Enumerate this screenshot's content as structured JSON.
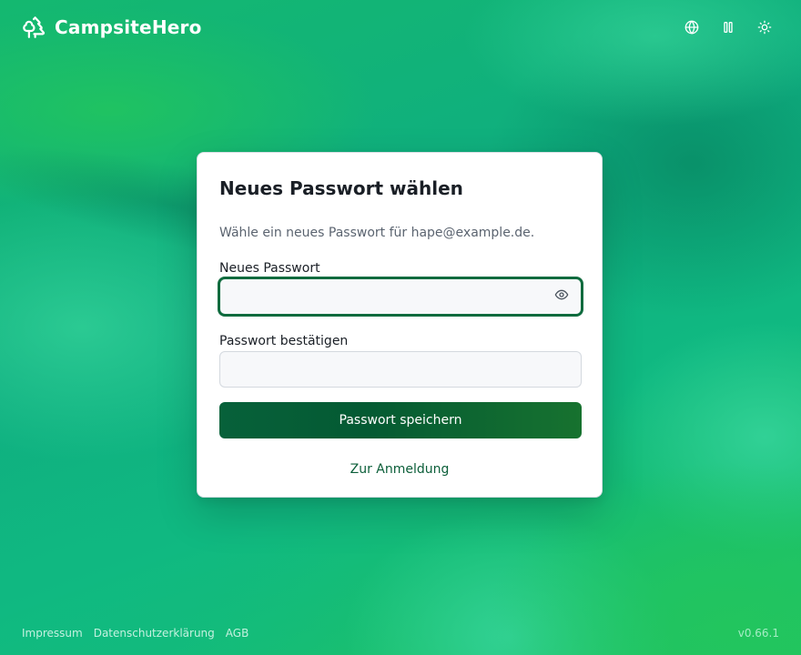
{
  "app": {
    "brand_name": "CampsiteHero",
    "brand_icon": "trees-icon",
    "version": "v0.66.1"
  },
  "header": {
    "actions": [
      {
        "icon": "globe-icon",
        "label": "language"
      },
      {
        "icon": "pause-icon",
        "label": "pause"
      },
      {
        "icon": "sun-icon",
        "label": "theme"
      }
    ]
  },
  "form": {
    "title": "Neues Passwort wählen",
    "description": "Wähle ein neues Passwort für hape@example.de.",
    "new_password": {
      "label": "Neues Passwort",
      "value": "",
      "placeholder": "",
      "toggle_icon": "eye-icon"
    },
    "confirm_password": {
      "label": "Passwort bestätigen",
      "value": "",
      "placeholder": ""
    },
    "submit_label": "Passwort speichern",
    "back_link": "Zur Anmeldung"
  },
  "footer": {
    "links": [
      "Impressum",
      "Datenschutzerklärung",
      "AGB"
    ]
  },
  "colors": {
    "accent": "#0b5e39",
    "button": "#07613a",
    "background": "#10b981"
  }
}
